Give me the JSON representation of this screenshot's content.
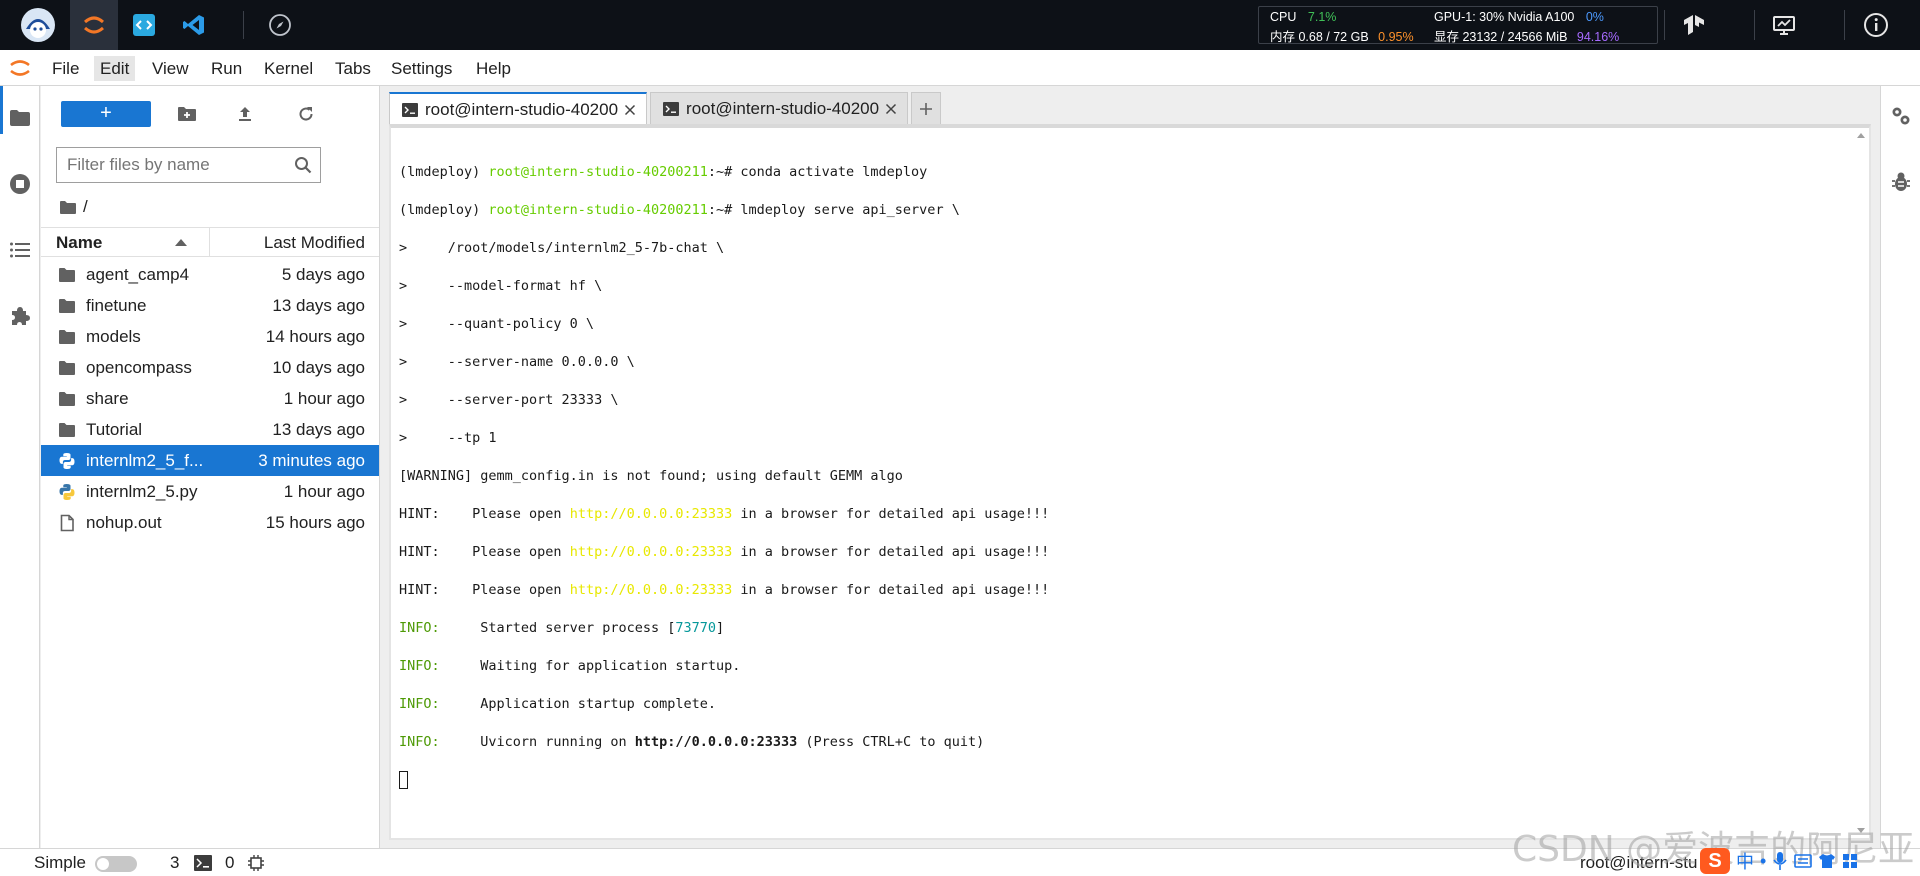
{
  "topbar": {
    "apps": [
      "intern-studio-logo-icon",
      "jupyter-icon",
      "code-icon",
      "vscode-icon",
      "compass-icon"
    ],
    "resources": {
      "cpu_label": "CPU",
      "cpu_value": "7.1%",
      "mem_label": "内存 0.68 / 72 GB",
      "mem_pct": "0.95%",
      "gpu_label": "GPU-1: 30% Nvidia A100",
      "gpu_pct": "0%",
      "vram_label": "显存 23132 / 24566 MiB",
      "vram_pct": "94.16%"
    },
    "right_icons": [
      "tensorflow-icon",
      "monitor-icon",
      "info-icon"
    ]
  },
  "menubar": {
    "items": [
      "File",
      "Edit",
      "View",
      "Run",
      "Kernel",
      "Tabs",
      "Settings",
      "Help"
    ],
    "active": "Edit"
  },
  "filebrowser": {
    "new_label": "+",
    "filter_placeholder": "Filter files by name",
    "breadcrumb": "/",
    "col_name": "Name",
    "col_modified": "Last Modified",
    "files": [
      {
        "name": "agent_camp4",
        "modified": "5 days ago",
        "type": "folder"
      },
      {
        "name": "finetune",
        "modified": "13 days ago",
        "type": "folder"
      },
      {
        "name": "models",
        "modified": "14 hours ago",
        "type": "folder"
      },
      {
        "name": "opencompass",
        "modified": "10 days ago",
        "type": "folder"
      },
      {
        "name": "share",
        "modified": "1 hour ago",
        "type": "folder"
      },
      {
        "name": "Tutorial",
        "modified": "13 days ago",
        "type": "folder"
      },
      {
        "name": "internlm2_5_f...",
        "modified": "3 minutes ago",
        "type": "python",
        "selected": true
      },
      {
        "name": "internlm2_5.py",
        "modified": "1 hour ago",
        "type": "python"
      },
      {
        "name": "nohup.out",
        "modified": "15 hours ago",
        "type": "file"
      }
    ]
  },
  "tabs": [
    {
      "label": "root@intern-studio-40200",
      "active": true
    },
    {
      "label": "root@intern-studio-40200",
      "active": false
    }
  ],
  "terminal": {
    "prompt_env": "(lmdeploy) ",
    "prompt_user": "root@intern-studio-40200211",
    "prompt_suffix": ":~# ",
    "cmd1": "conda activate lmdeploy",
    "cmd2": "lmdeploy serve api_server \\",
    "cont_lines": [
      ">     /root/models/internlm2_5-7b-chat \\",
      ">     --model-format hf \\",
      ">     --quant-policy 0 \\",
      ">     --server-name 0.0.0.0 \\",
      ">     --server-port 23333 \\",
      ">     --tp 1"
    ],
    "warning": "[WARNING] gemm_config.in is not found; using default GEMM algo",
    "hint_prefix": "HINT:    Please open ",
    "hint_url": "http://0.0.0.0:23333",
    "hint_suffix": " in a browser for detailed api usage!!!",
    "info_label": "INFO:",
    "info_started": "     Started server process [",
    "pid": "73770",
    "info_started_end": "]",
    "info_waiting": "     Waiting for application startup.",
    "info_complete": "     Application startup complete.",
    "info_uvicorn": "     Uvicorn running on ",
    "uvicorn_url": "http://0.0.0.0:23333",
    "uvicorn_end": " (Press CTRL+C to quit)"
  },
  "statusbar": {
    "simple_label": "Simple",
    "count_terminals": "3",
    "count_kernels": "0",
    "right_text": "root@intern-stu"
  },
  "watermark": "CSDN @爱波吉的阿尼亚",
  "tray": {
    "s": "S",
    "zh": "中"
  }
}
